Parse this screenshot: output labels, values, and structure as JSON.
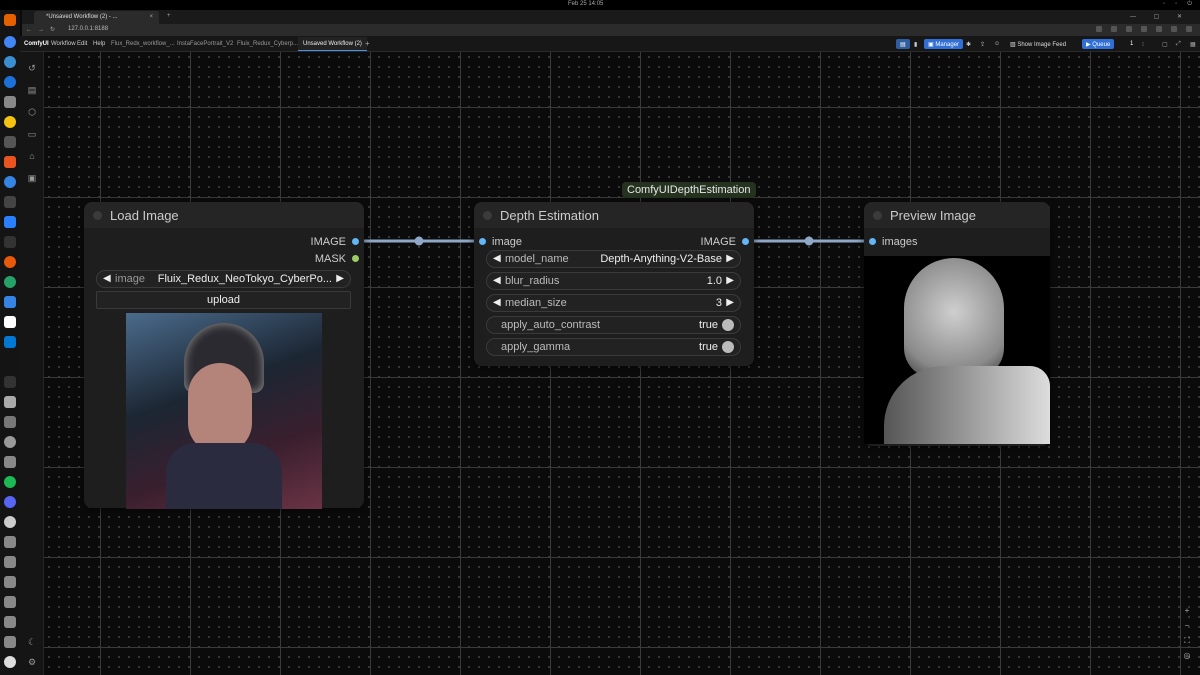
{
  "os_bar": {
    "clock": "Feb 25 14:05"
  },
  "browser": {
    "tab_title": "*Unsaved Workflow (2) - ...",
    "tab_close": "×",
    "new_tab": "+",
    "url": "127.0.0.1:8188"
  },
  "app": {
    "name": "ComfyUI",
    "menu": [
      "Workflow",
      "Edit",
      "Help"
    ],
    "workflow_tabs": [
      "Flux_Redx_workflow_...",
      "InstaFacePortrait_V2",
      "Fluix_Redux_Cyberp...",
      "Unsaved Workflow (2)"
    ],
    "active_tab_index": 3,
    "add_tab": "+",
    "manager_label": "Manager",
    "show_image_feed": "Show Image Feed",
    "queue_label": "Queue",
    "queue_count": "1"
  },
  "nodes": {
    "load_image": {
      "title": "Load Image",
      "outputs": [
        "IMAGE",
        "MASK"
      ],
      "image_widget_label": "image",
      "image_widget_value": "Fluix_Redux_NeoTokyo_CyberPo...",
      "upload_label": "upload"
    },
    "depth": {
      "tooltip": "ComfyUIDepthEstimation",
      "title": "Depth Estimation",
      "input": "image",
      "output": "IMAGE",
      "widgets": [
        {
          "name": "model_name",
          "value": "Depth-Anything-V2-Base"
        },
        {
          "name": "blur_radius",
          "value": "1.0"
        },
        {
          "name": "median_size",
          "value": "3"
        },
        {
          "name": "apply_auto_contrast",
          "value": "true"
        },
        {
          "name": "apply_gamma",
          "value": "true"
        }
      ]
    },
    "preview": {
      "title": "Preview Image",
      "input": "images"
    }
  },
  "colors": {
    "link": "#8fa8c8",
    "image_pin": "#64b5f6",
    "mask_pin": "#9ccc65",
    "accent": "#2f6fd6"
  }
}
